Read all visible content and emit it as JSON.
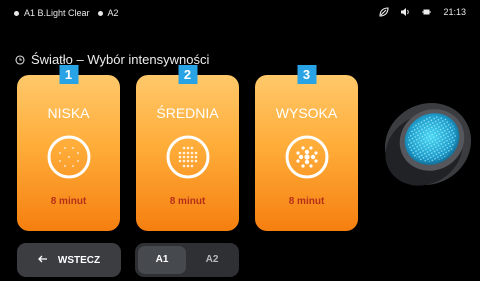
{
  "status": {
    "items": [
      "A1 B.Light Clear",
      "A2"
    ],
    "time": "21:13",
    "icons": [
      "leaf-icon",
      "speaker-icon",
      "plug-icon"
    ]
  },
  "heading": {
    "text": "Światło – Wybór intensywności"
  },
  "cards": [
    {
      "number": "1",
      "label": "NISKA",
      "duration": "8 minut"
    },
    {
      "number": "2",
      "label": "ŚREDNIA",
      "duration": "8 minut"
    },
    {
      "number": "3",
      "label": "WYSOKA",
      "duration": "8 minut"
    }
  ],
  "footer": {
    "back_label": "WSTECZ",
    "segment_options": [
      "A1",
      "A2"
    ],
    "segment_selected": "A1"
  },
  "colors": {
    "card_top": "#ffc86a",
    "card_bottom": "#f57f10",
    "badge": "#27a3e6",
    "duration_text": "#b5301a"
  }
}
